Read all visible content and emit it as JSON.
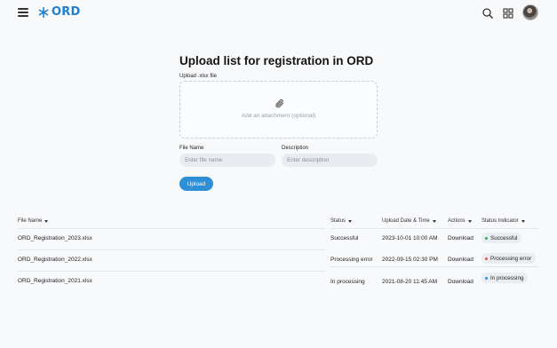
{
  "header": {
    "logo_text": "ORD",
    "icons": [
      "menu-icon",
      "asterisk-logo-icon",
      "search-icon",
      "grid-icon",
      "user-avatar"
    ],
    "brand_color": "#1f7fd1"
  },
  "form": {
    "title": "Upload list for registration in ORD",
    "file_label": "Upload .xlsx file",
    "dropzone_text": "Add an attachment (optional)",
    "file_name_label": "File Name",
    "file_name_placeholder": "Enter file name",
    "description_label": "Description",
    "description_placeholder": "Enter description",
    "upload_button": "Upload"
  },
  "table": {
    "columns": [
      "File Name",
      "Status",
      "Upload Date & Time",
      "Actions",
      "Status Indicator"
    ],
    "rows": [
      {
        "file_name": "ORD_Registration_2023.xlsx",
        "status": "Successful",
        "date": "2023-10-01 10:00 AM",
        "action": "Download",
        "indicator": "Successful",
        "indicator_color": "#3aa55d"
      },
      {
        "file_name": "ORD_Registration_2022.xlsx",
        "status": "Processing error",
        "date": "2022-09-15 02:30 PM",
        "action": "Download",
        "indicator": "Processing error",
        "indicator_color": "#d9534f"
      },
      {
        "file_name": "ORD_Registration_2021.xlsx",
        "status": "In processing",
        "date": "2021-08-20 11:45 AM",
        "action": "Download",
        "indicator": "In processing",
        "indicator_color": "#2f8fd6"
      }
    ]
  }
}
